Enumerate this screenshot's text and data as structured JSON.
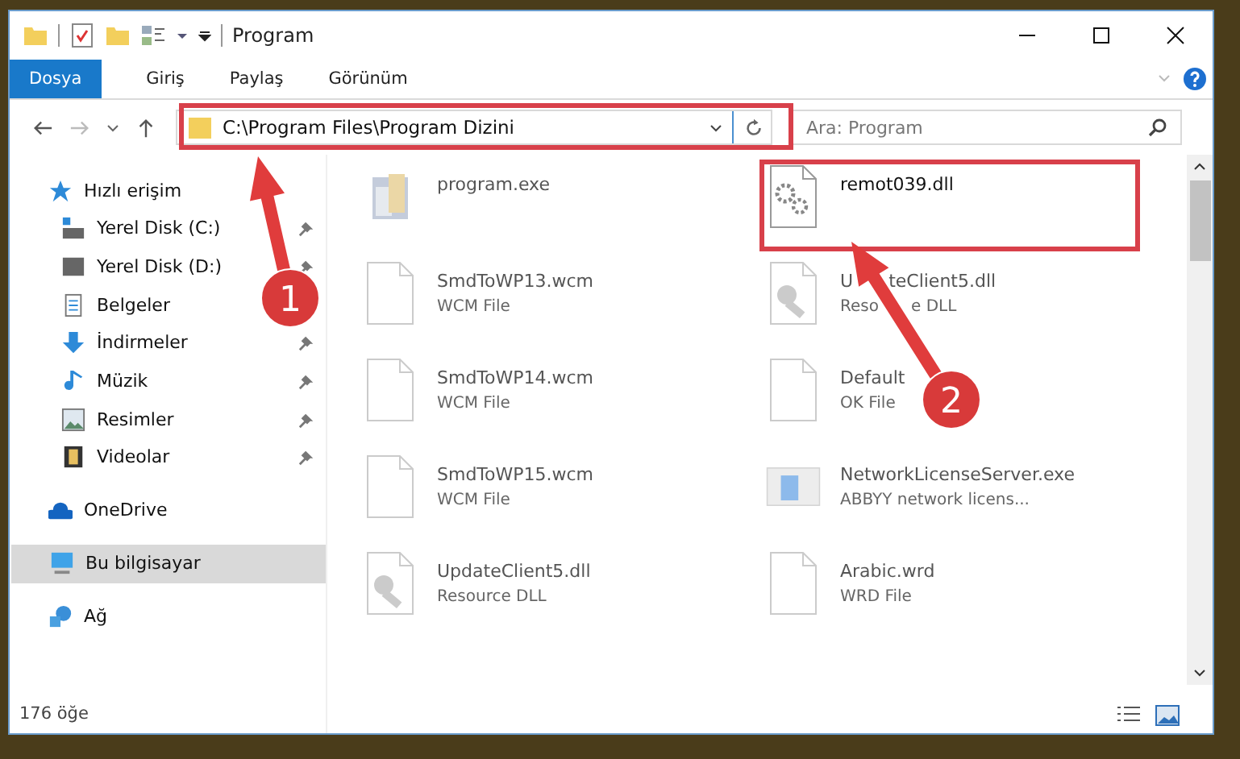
{
  "window": {
    "title": "Program"
  },
  "ribbon_tabs": [
    {
      "label": "Dosya",
      "selected": true
    },
    {
      "label": "Giriş",
      "selected": false
    },
    {
      "label": "Paylaş",
      "selected": false
    },
    {
      "label": "Görünüm",
      "selected": false
    }
  ],
  "address_bar": {
    "path": "C:\\Program Files\\Program Dizini"
  },
  "search": {
    "placeholder": "Ara: Program"
  },
  "sidebar": {
    "items": [
      {
        "label": "Hızlı erişim",
        "kind": "star",
        "selected": false,
        "children": [
          {
            "label": "Yerel Disk (C:)",
            "kind": "drive-c",
            "pinned": true
          },
          {
            "label": "Yerel Disk (D:)",
            "kind": "drive",
            "pinned": true
          },
          {
            "label": "Belgeler",
            "kind": "docs",
            "pinned": false
          },
          {
            "label": "İndirmeler",
            "kind": "download",
            "pinned": true
          },
          {
            "label": "Müzik",
            "kind": "music",
            "pinned": true
          },
          {
            "label": "Resimler",
            "kind": "pictures",
            "pinned": true
          },
          {
            "label": "Videolar",
            "kind": "videos",
            "pinned": true
          }
        ]
      },
      {
        "label": "OneDrive",
        "kind": "cloud",
        "selected": false
      },
      {
        "label": "Bu bilgisayar",
        "kind": "pc",
        "selected": true
      },
      {
        "label": "Ağ",
        "kind": "network",
        "selected": false
      }
    ]
  },
  "files": [
    {
      "name": "program.exe",
      "kind": "exe",
      "blurred": true,
      "highlighted": false
    },
    {
      "name": "remot039.dll",
      "kind": "gears",
      "blurred": false,
      "highlighted": true
    },
    {
      "name": "SmdToWP13.wcm",
      "type": "WCM File",
      "kind": "blank",
      "blurred": true,
      "highlighted": false
    },
    {
      "name_parts": [
        "U",
        "teClient5.dll"
      ],
      "type_parts": [
        "Reso",
        "e DLL"
      ],
      "kind": "resource",
      "blurred": true,
      "highlighted": false
    },
    {
      "name": "SmdToWP14.wcm",
      "type": "WCM File",
      "kind": "blank",
      "blurred": true,
      "highlighted": false
    },
    {
      "name": "Default",
      "type": "OK File",
      "kind": "blank",
      "blurred": true,
      "highlighted": false
    },
    {
      "name": "SmdToWP15.wcm",
      "type": "WCM File",
      "kind": "blank",
      "blurred": true,
      "highlighted": false
    },
    {
      "name": "NetworkLicenseServer.exe",
      "type": "ABBYY network licens...",
      "kind": "app",
      "blurred": true,
      "highlighted": false
    },
    {
      "name": "UpdateClient5.dll",
      "type": "Resource DLL",
      "kind": "resource",
      "blurred": true,
      "highlighted": false
    },
    {
      "name": "Arabic.wrd",
      "type": "WRD File",
      "kind": "blank",
      "blurred": true,
      "highlighted": false
    }
  ],
  "annotations": [
    {
      "label": "1"
    },
    {
      "label": "2"
    }
  ],
  "status_bar": {
    "count": "176 öğe"
  }
}
